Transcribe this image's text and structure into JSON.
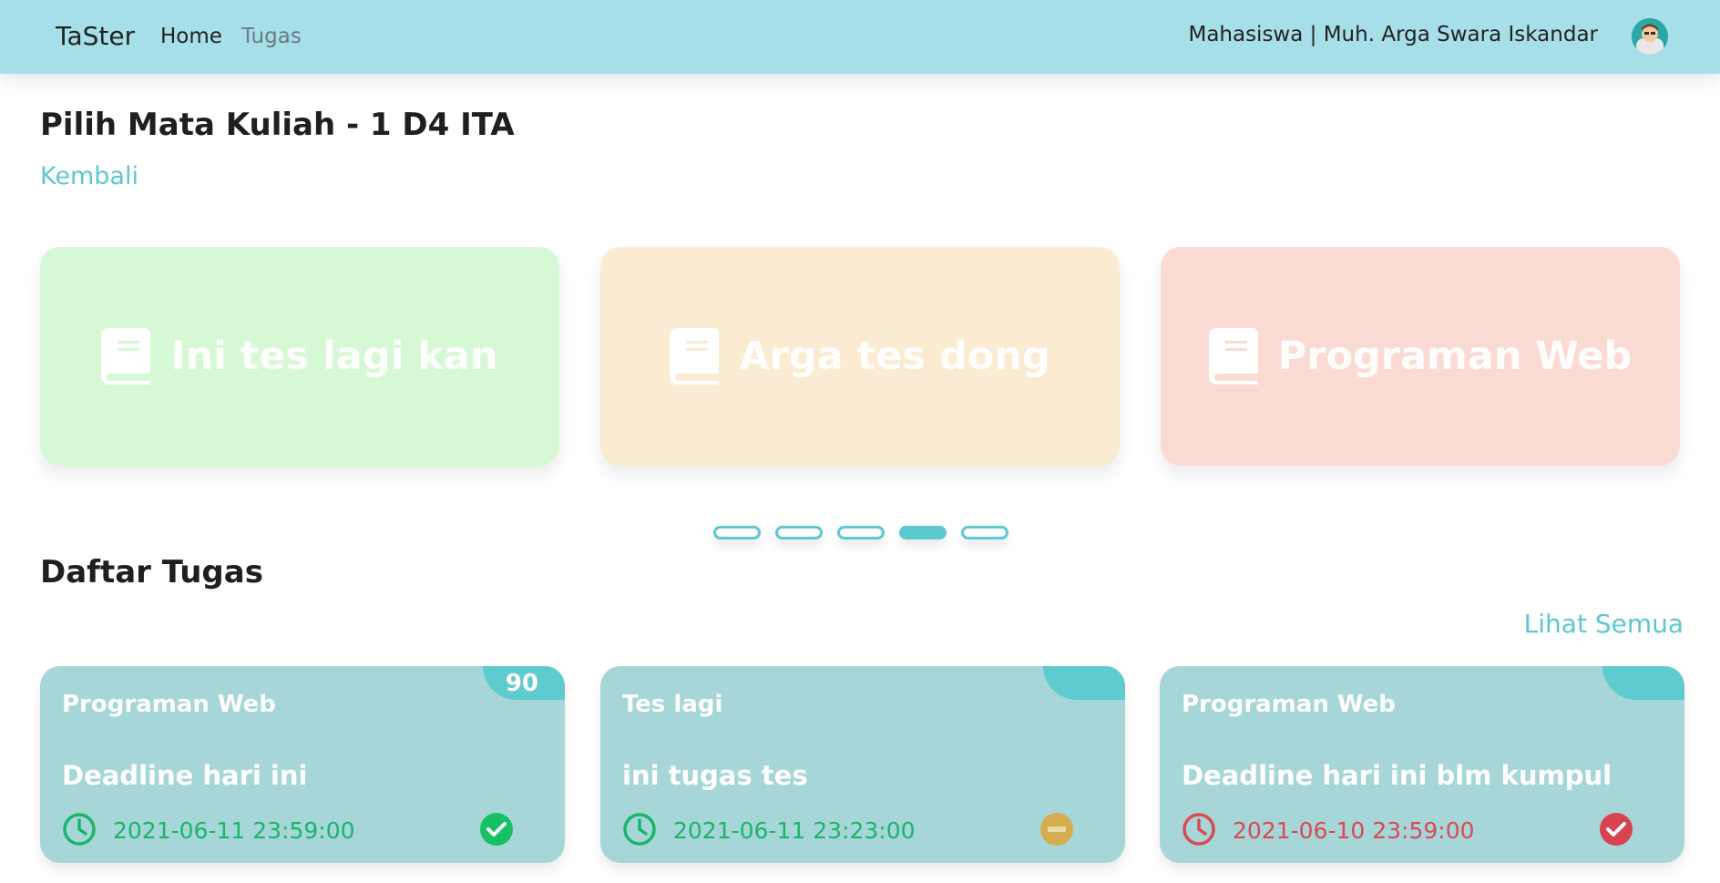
{
  "navbar": {
    "brand": "TaSter",
    "links": [
      {
        "label": "Home"
      },
      {
        "label": "Tugas"
      }
    ],
    "user_text": "Mahasiswa | Muh. Arga Swara Iskandar"
  },
  "page_title": "Pilih Mata Kuliah - 1 D4 ITA",
  "back_label": "Kembali",
  "courses": [
    {
      "title": "Ini tes lagi kan",
      "icon": "book-icon",
      "color": "#d7f8d4"
    },
    {
      "title": "Arga tes dong",
      "icon": "book-icon",
      "color": "#faebd2"
    },
    {
      "title": "Programan Web",
      "icon": "book-icon",
      "color": "#f9dbd3"
    }
  ],
  "carousel": {
    "dot_count": 5,
    "active_index": 3,
    "accent": "#5cc8cf"
  },
  "section_title": "Daftar Tugas",
  "see_all_label": "Lihat Semua",
  "tasks": [
    {
      "course": "Programan Web",
      "title": "Deadline hari ini",
      "deadline": "2021-06-11 23:59:00",
      "score": "90",
      "status": "submitted",
      "status_icon": "check-circle-icon",
      "deadline_color": "#1ab56b"
    },
    {
      "course": "Tes lagi",
      "title": "ini tugas tes",
      "deadline": "2021-06-11 23:23:00",
      "score": "",
      "status": "pending",
      "status_icon": "minus-circle-icon",
      "deadline_color": "#1ab56b"
    },
    {
      "course": "Programan Web",
      "title": "Deadline hari ini blm kumpul",
      "deadline": "2021-06-10 23:59:00",
      "score": "",
      "status": "late",
      "status_icon": "check-circle-icon",
      "deadline_color": "#d84a55"
    }
  ]
}
